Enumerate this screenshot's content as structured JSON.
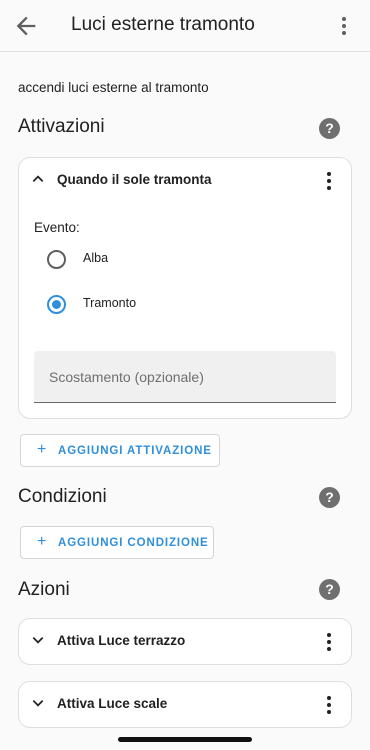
{
  "appbar": {
    "title": "Luci esterne tramonto",
    "back_icon": "arrow-left-icon",
    "menu_icon": "dots-vertical-icon"
  },
  "description": "accendi luci esterne al tramonto",
  "sections": {
    "triggers": {
      "title": "Attivazioni",
      "help": "?"
    },
    "conditions": {
      "title": "Condizioni",
      "help": "?"
    },
    "actions": {
      "title": "Azioni",
      "help": "?"
    }
  },
  "trigger_card": {
    "title": "Quando il sole tramonta",
    "event_label": "Evento:",
    "options": [
      {
        "label": "Alba",
        "selected": false
      },
      {
        "label": "Tramonto",
        "selected": true
      }
    ],
    "offset": {
      "value": "",
      "placeholder": "Scostamento (opzionale)"
    }
  },
  "buttons": {
    "add_trigger": "AGGIUNGI ATTIVAZIONE",
    "add_condition": "AGGIUNGI CONDIZIONE",
    "plus": "+"
  },
  "actions": [
    {
      "title": "Attiva Luce terrazzo"
    },
    {
      "title": "Attiva Luce scale"
    }
  ],
  "colors": {
    "accent": "#2f8fdc",
    "background": "#fafafa",
    "card": "#ffffff"
  }
}
